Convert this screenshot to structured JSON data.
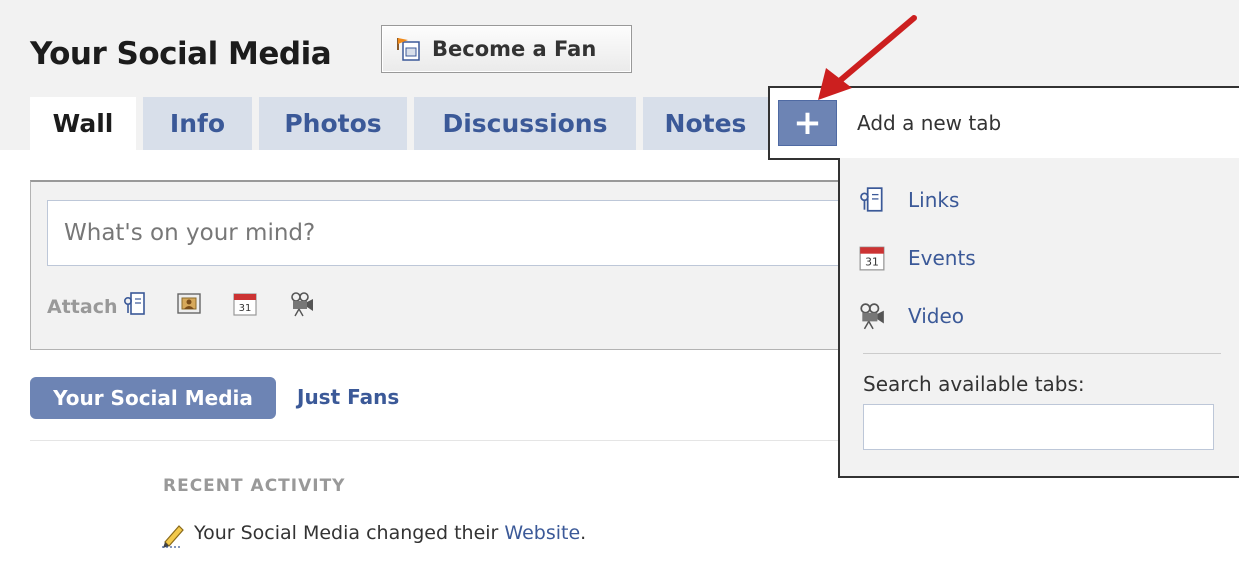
{
  "page": {
    "title": "Your Social Media",
    "fan_button_label": "Become a Fan"
  },
  "tabs": [
    {
      "label": "Wall",
      "active": true
    },
    {
      "label": "Info",
      "active": false
    },
    {
      "label": "Photos",
      "active": false
    },
    {
      "label": "Discussions",
      "active": false
    },
    {
      "label": "Notes",
      "active": false
    }
  ],
  "composer": {
    "placeholder": "What's on your mind?",
    "attach_label": "Attach",
    "attach_icons": [
      "link-icon",
      "photo-icon",
      "calendar-icon",
      "video-camera-icon"
    ]
  },
  "filter": {
    "active_label": "Your Social Media",
    "other_label": "Just Fans"
  },
  "activity": {
    "heading": "RECENT ACTIVITY",
    "text": "Your Social Media changed their ",
    "link": "Website",
    "suffix": "."
  },
  "add_tab_menu": {
    "header_label": "Add a new tab",
    "plus_symbol": "+",
    "items": [
      {
        "label": "Links",
        "icon": "link-icon"
      },
      {
        "label": "Events",
        "icon": "calendar-icon"
      },
      {
        "label": "Video",
        "icon": "video-camera-icon"
      }
    ],
    "search_label": "Search available tabs:",
    "search_value": ""
  },
  "colors": {
    "brand_blue": "#3b5998",
    "tab_blue": "#d8dfea",
    "pill_blue": "#6d84b4",
    "annotation_arrow": "#cc1f1f"
  },
  "calendar_day": "31"
}
